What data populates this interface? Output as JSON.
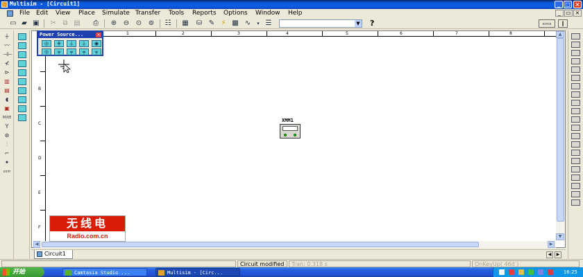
{
  "window": {
    "title": "Multisim - [Circuit1]",
    "controls": [
      "_",
      "□",
      "×"
    ],
    "mdi_controls": [
      "_",
      "▭",
      "×"
    ]
  },
  "menu": [
    "File",
    "Edit",
    "View",
    "Place",
    "Simulate",
    "Transfer",
    "Tools",
    "Reports",
    "Options",
    "Window",
    "Help"
  ],
  "toolbar": {
    "icons": [
      "new-icon",
      "open-icon",
      "save-icon",
      "cut-icon",
      "copy-icon",
      "paste-icon",
      "print-icon",
      "zoom-in-icon",
      "zoom-out-icon",
      "zoom-area-icon",
      "zoom-fit-icon",
      "hierarchy-icon",
      "spreadsheet-icon",
      "database-icon",
      "component-wizard-icon",
      "postprocessor-icon",
      "grapher-icon",
      "analysis-icon",
      "in-use-list-icon",
      "help-icon"
    ],
    "combo_value": "",
    "help_label": "?"
  },
  "palette": {
    "title": "Power Source..."
  },
  "ruler": {
    "columns": [
      "1",
      "2",
      "3",
      "4",
      "5",
      "6",
      "7",
      "8"
    ],
    "rows": [
      "B",
      "C",
      "D",
      "E",
      "F"
    ]
  },
  "schematic": {
    "instrument_label": "XMM1"
  },
  "logo": {
    "hanzi": "无线电",
    "url": "Radio.com.cn"
  },
  "tabs": [
    {
      "label": "Circuit1"
    }
  ],
  "status": {
    "message": "Circuit modified",
    "tran": "Tran: 0.318 s",
    "key": "OnKeyUp( 46d )"
  },
  "taskbar": {
    "start": "开始",
    "tasks": [
      "Camtasia Studio ...",
      "Multisim - [Circ..."
    ],
    "clock": "16:25"
  }
}
